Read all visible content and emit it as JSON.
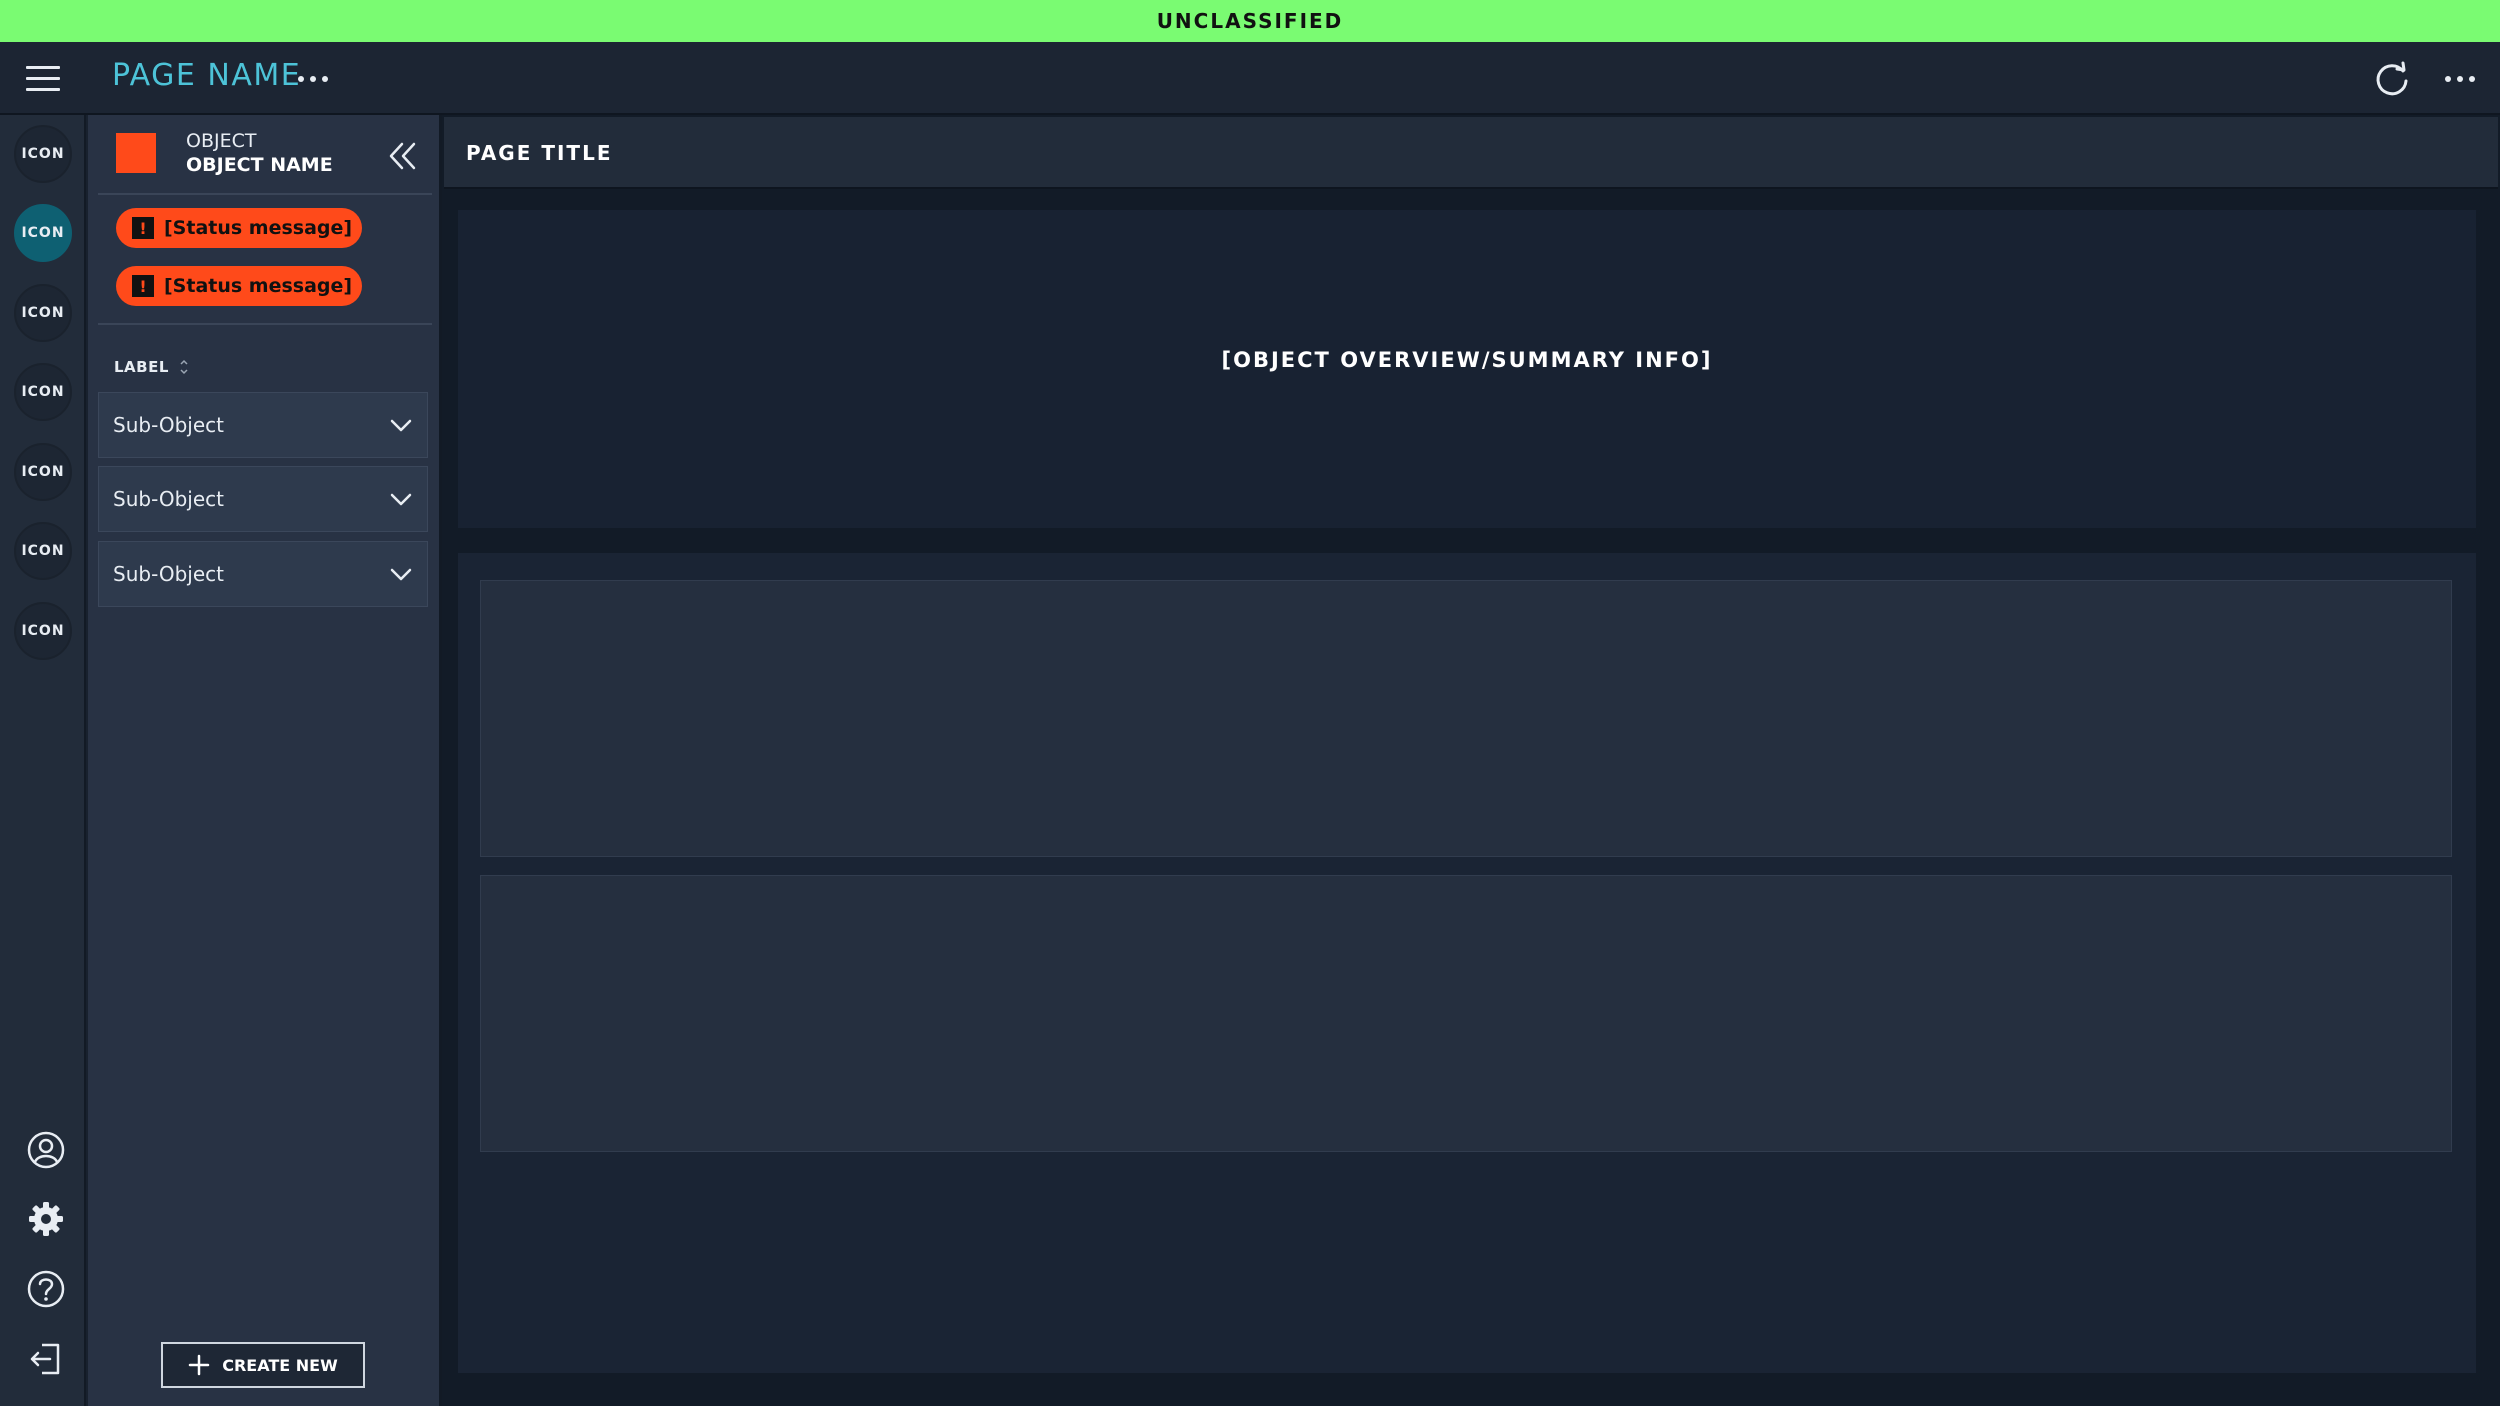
{
  "banner": {
    "classification": "UNCLASSIFIED"
  },
  "header": {
    "page_name": "PAGE NAME"
  },
  "rail": {
    "items": [
      {
        "label": "ICON",
        "active": false
      },
      {
        "label": "ICON",
        "active": true
      },
      {
        "label": "ICON",
        "active": false
      },
      {
        "label": "ICON",
        "active": false
      },
      {
        "label": "ICON",
        "active": false
      },
      {
        "label": "ICON",
        "active": false
      },
      {
        "label": "ICON",
        "active": false
      }
    ],
    "footer_icons": [
      "user-icon",
      "gear-icon",
      "help-icon",
      "logout-icon"
    ]
  },
  "panel": {
    "object_type": "OBJECT",
    "object_name": "OBJECT NAME",
    "object_color": "#ff4a1a",
    "status_messages": [
      "[Status message]",
      "[Status message]"
    ],
    "list_label": "LABEL",
    "sub_objects": [
      "Sub-Object",
      "Sub-Object",
      "Sub-Object"
    ],
    "create_label": "CREATE NEW"
  },
  "main": {
    "title": "PAGE TITLE",
    "overview_placeholder": "[OBJECT OVERVIEW/SUMMARY INFO]"
  },
  "colors": {
    "banner": "#7afb72",
    "accent": "#4dc3d8",
    "status": "#ff4a1a",
    "active_rail": "#0e6072"
  }
}
